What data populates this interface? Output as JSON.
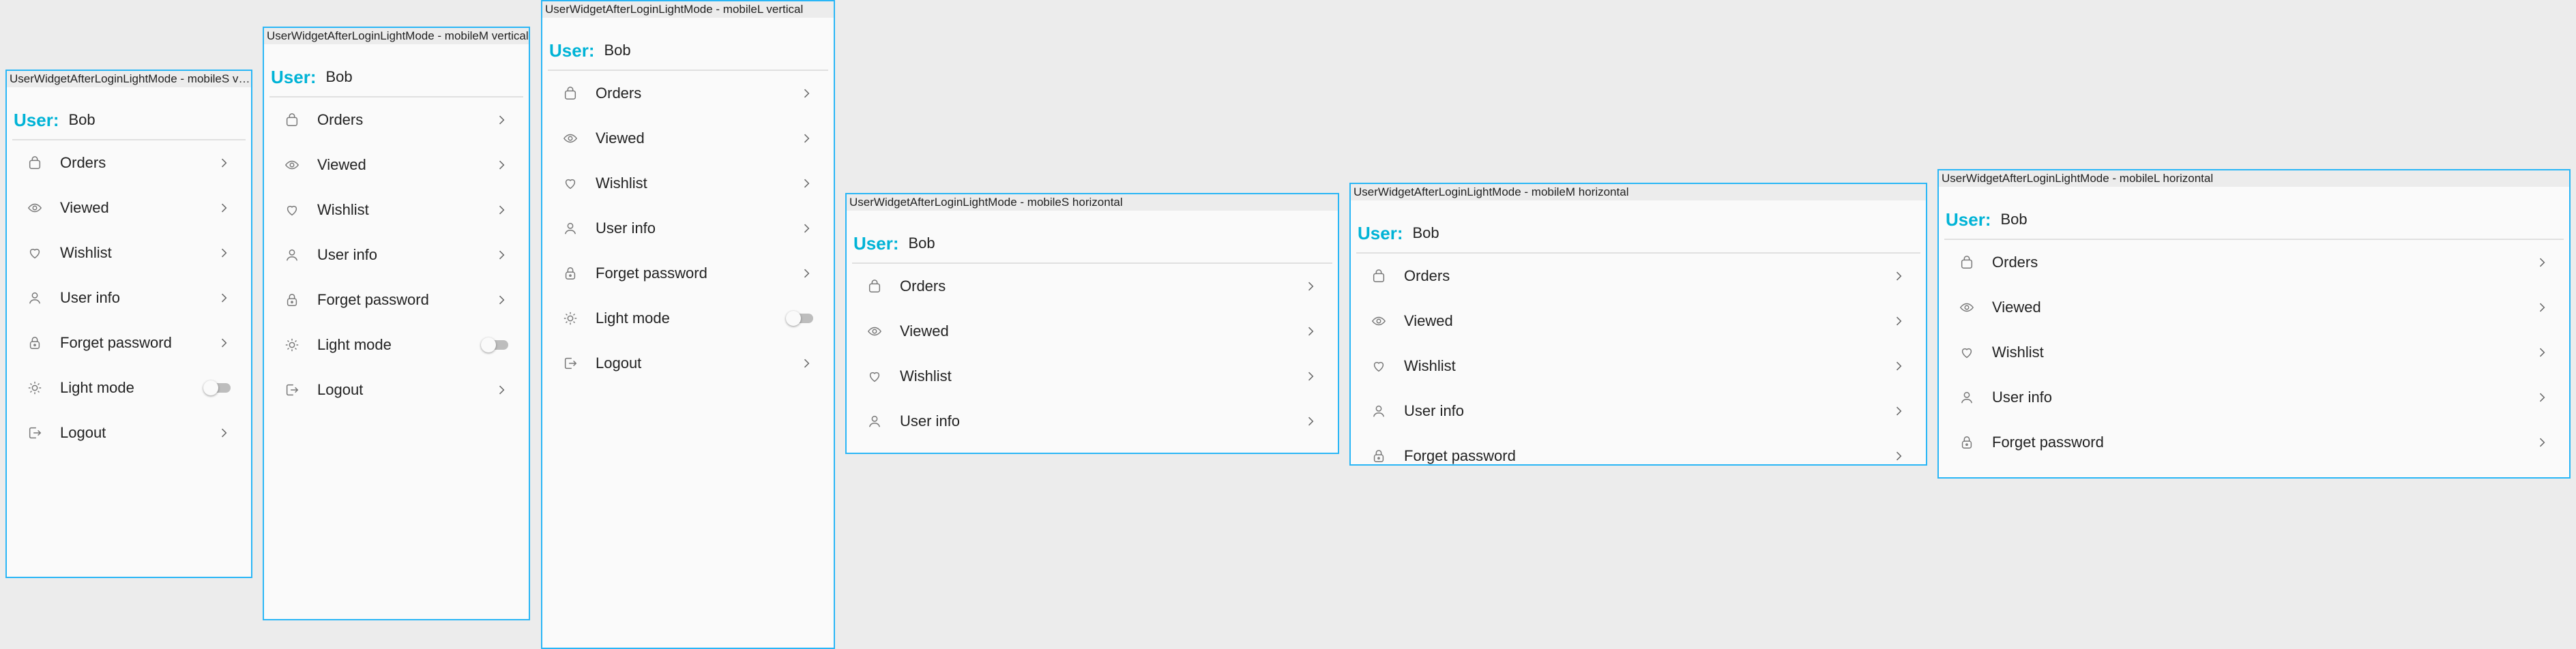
{
  "colors": {
    "accent": "#00b3d6",
    "frame_border": "#29b6f6",
    "canvas": "#ececec",
    "panel": "#fafafa"
  },
  "frames": [
    {
      "title": "UserWidgetAfterLoginLightMode - mobileS vertical",
      "user_label": "User:",
      "user_name": "Bob",
      "items": [
        {
          "label": "Orders",
          "icon": "bag-icon"
        },
        {
          "label": "Viewed",
          "icon": "eye-icon"
        },
        {
          "label": "Wishlist",
          "icon": "heart-icon"
        },
        {
          "label": "User info",
          "icon": "person-icon"
        },
        {
          "label": "Forget password",
          "icon": "lock-icon"
        },
        {
          "label": "Light mode",
          "icon": "sun-icon"
        },
        {
          "label": "Logout",
          "icon": "logout-icon"
        }
      ]
    },
    {
      "title": "UserWidgetAfterLoginLightMode - mobileM vertical",
      "user_label": "User:",
      "user_name": "Bob",
      "items": [
        {
          "label": "Orders",
          "icon": "bag-icon"
        },
        {
          "label": "Viewed",
          "icon": "eye-icon"
        },
        {
          "label": "Wishlist",
          "icon": "heart-icon"
        },
        {
          "label": "User info",
          "icon": "person-icon"
        },
        {
          "label": "Forget password",
          "icon": "lock-icon"
        },
        {
          "label": "Light mode",
          "icon": "sun-icon"
        },
        {
          "label": "Logout",
          "icon": "logout-icon"
        }
      ]
    },
    {
      "title": "UserWidgetAfterLoginLightMode - mobileL vertical",
      "user_label": "User:",
      "user_name": "Bob",
      "items": [
        {
          "label": "Orders",
          "icon": "bag-icon"
        },
        {
          "label": "Viewed",
          "icon": "eye-icon"
        },
        {
          "label": "Wishlist",
          "icon": "heart-icon"
        },
        {
          "label": "User info",
          "icon": "person-icon"
        },
        {
          "label": "Forget password",
          "icon": "lock-icon"
        },
        {
          "label": "Light mode",
          "icon": "sun-icon"
        },
        {
          "label": "Logout",
          "icon": "logout-icon"
        }
      ]
    },
    {
      "title": "UserWidgetAfterLoginLightMode - mobileS horizontal",
      "user_label": "User:",
      "user_name": "Bob",
      "items": [
        {
          "label": "Orders",
          "icon": "bag-icon"
        },
        {
          "label": "Viewed",
          "icon": "eye-icon"
        },
        {
          "label": "Wishlist",
          "icon": "heart-icon"
        },
        {
          "label": "User info",
          "icon": "person-icon"
        }
      ]
    },
    {
      "title": "UserWidgetAfterLoginLightMode - mobileM horizontal",
      "user_label": "User:",
      "user_name": "Bob",
      "items": [
        {
          "label": "Orders",
          "icon": "bag-icon"
        },
        {
          "label": "Viewed",
          "icon": "eye-icon"
        },
        {
          "label": "Wishlist",
          "icon": "heart-icon"
        },
        {
          "label": "User info",
          "icon": "person-icon"
        },
        {
          "label": "Forget password",
          "icon": "lock-icon"
        }
      ]
    },
    {
      "title": "UserWidgetAfterLoginLightMode - mobileL horizontal",
      "user_label": "User:",
      "user_name": "Bob",
      "items": [
        {
          "label": "Orders",
          "icon": "bag-icon"
        },
        {
          "label": "Viewed",
          "icon": "eye-icon"
        },
        {
          "label": "Wishlist",
          "icon": "heart-icon"
        },
        {
          "label": "User info",
          "icon": "person-icon"
        },
        {
          "label": "Forget password",
          "icon": "lock-icon"
        }
      ]
    }
  ]
}
